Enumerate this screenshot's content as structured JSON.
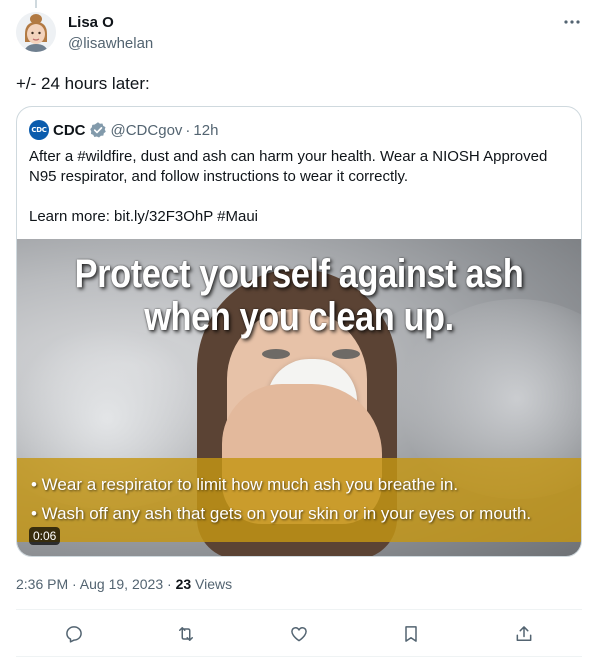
{
  "author": {
    "display_name": "Lisa O",
    "handle": "@lisawhelan"
  },
  "tweet": {
    "text": "+/- 24 hours later:",
    "timestamp": "2:36 PM · Aug 19, 2023",
    "separator": " · ",
    "views_count": "23",
    "views_label": " Views"
  },
  "quoted": {
    "logo_text": "CDC",
    "display_name": "CDC",
    "handle": "@CDCgov",
    "dot": "·",
    "time": "12h",
    "text_line1": "After a #wildfire, dust and ash can harm your health. Wear a NIOSH Approved N95 respirator, and follow instructions to wear it correctly.",
    "text_line2": "Learn more: bit.ly/32F3OhP #Maui",
    "media": {
      "headline_line1": "Protect yourself against ash",
      "headline_line2": "when you clean up.",
      "bullet1": "• Wear a respirator to limit how much ash you breathe in.",
      "bullet2": "• Wash off any ash that gets on your skin or in your eyes or mouth.",
      "duration": "0:06"
    }
  },
  "icons": {
    "more": "more-icon",
    "verified": "verified-badge-icon",
    "reply": "reply-icon",
    "retweet": "retweet-icon",
    "like": "like-icon",
    "bookmark": "bookmark-icon",
    "share": "share-icon"
  },
  "colors": {
    "text_primary": "#0f1419",
    "text_secondary": "#536471",
    "border": "#cfd9de",
    "cdc_blue": "#0b5cad",
    "band_gold": "#c49614"
  }
}
